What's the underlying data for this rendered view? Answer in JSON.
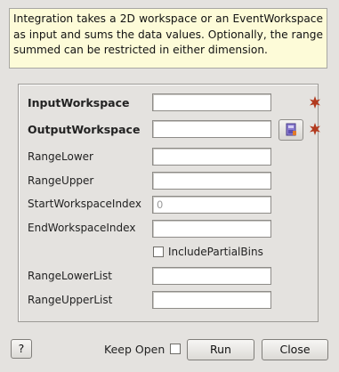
{
  "description": "Integration takes a 2D workspace or an EventWorkspace as input and sums the data values. Optionally, the range summed can be restricted in either dimension.",
  "fields": {
    "input_workspace": {
      "label": "InputWorkspace",
      "value": ""
    },
    "output_workspace": {
      "label": "OutputWorkspace",
      "value": ""
    },
    "range_lower": {
      "label": "RangeLower",
      "value": ""
    },
    "range_upper": {
      "label": "RangeUpper",
      "value": ""
    },
    "start_workspace_index": {
      "label": "StartWorkspaceIndex",
      "value": "0"
    },
    "end_workspace_index": {
      "label": "EndWorkspaceIndex",
      "value": ""
    },
    "range_lower_list": {
      "label": "RangeLowerList",
      "value": ""
    },
    "range_upper_list": {
      "label": "RangeUpperList",
      "value": ""
    }
  },
  "include_partial_bins": {
    "label": "IncludePartialBins",
    "checked": false
  },
  "footer": {
    "help_label": "?",
    "keep_open_label": "Keep Open",
    "keep_open_checked": false,
    "run_label": "Run",
    "close_label": "Close"
  },
  "icons": {
    "mandatory": "required-star-icon",
    "browse": "workspace-browse-icon"
  },
  "colors": {
    "description_bg": "#fdfbd8",
    "mandatory_star": "#b23a1e"
  }
}
